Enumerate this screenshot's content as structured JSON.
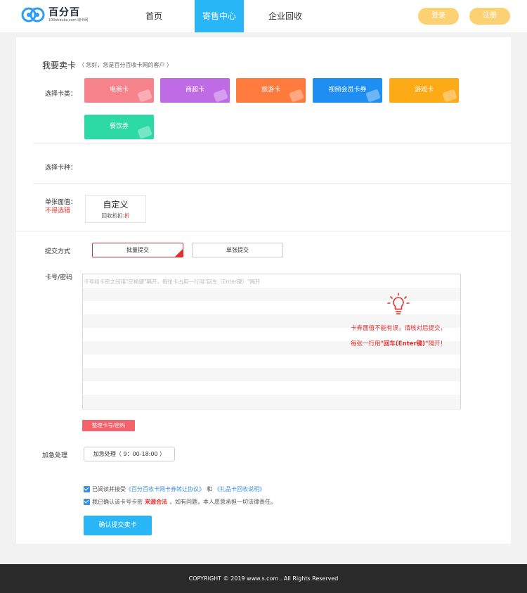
{
  "header": {
    "logo_name": "百分百",
    "logo_sub": "100shouka.com 收卡网",
    "nav": [
      "首页",
      "寄售中心",
      "企业回收"
    ],
    "login": "登录",
    "register": "注册"
  },
  "form": {
    "title": "我要卖卡",
    "title_hint": "（ 您好，您是百分百收卡网的客户 ）",
    "card_type_label": "选择卡类：",
    "card_types": [
      {
        "label": "电商卡",
        "color": "#f6828c"
      },
      {
        "label": "商超卡",
        "color": "#c06be6"
      },
      {
        "label": "旅游卡",
        "color": "#ff7a3d"
      },
      {
        "label": "视频会员卡券",
        "color": "#1e8ef3"
      },
      {
        "label": "游戏卡",
        "color": "#fcaa16"
      },
      {
        "label": "餐饮券",
        "color": "#2dd9a5"
      }
    ],
    "card_kind_label": "选择卡种：",
    "face_label": "单张面值：",
    "face_warn": "不得选错",
    "face_name": "自定义",
    "face_sub_prefix": "回收折扣:",
    "face_sub_suffix": "折",
    "submit_mode_label": "提交方式",
    "mode_batch": "批量提交",
    "mode_single": "单张提交",
    "card_pwd_label": "卡号/密码",
    "textarea_placeholder": "卡号和卡密之间用\"空格键\"隔开，每张卡占用一行用\"回车（Enter键）\"隔开",
    "warn_line1": "卡券面值不能有误，请核对后提交，",
    "warn_line2_pre": "每张一行用",
    "warn_line2_bold": "\"回车(Enter键)\"",
    "warn_line2_post": "隔开！",
    "tidy_button": "整理卡号/密码",
    "urgent_label": "加急处理",
    "urgent_button": "加急处理（ 9：00-18:00 ）",
    "agree1_pre": "已阅读并接受",
    "agree1_link1": "《百分百收卡网卡券转让协议》",
    "agree1_mid": "和",
    "agree1_link2": "《礼品卡回收说明》",
    "agree2_pre": "我已确认该卡号卡密",
    "agree2_red": "来源合法",
    "agree2_post": "，如有问题，本人愿意承担一切法律责任。",
    "confirm_button": "确认提交卖卡"
  },
  "footer": {
    "copyright": "COPYRIGHT © 2019 www.s.com . All Rights Reserved"
  },
  "colors": {
    "accent": "#29b6f6",
    "warn_red": "#e03030",
    "header_btn": "#fbd173"
  }
}
